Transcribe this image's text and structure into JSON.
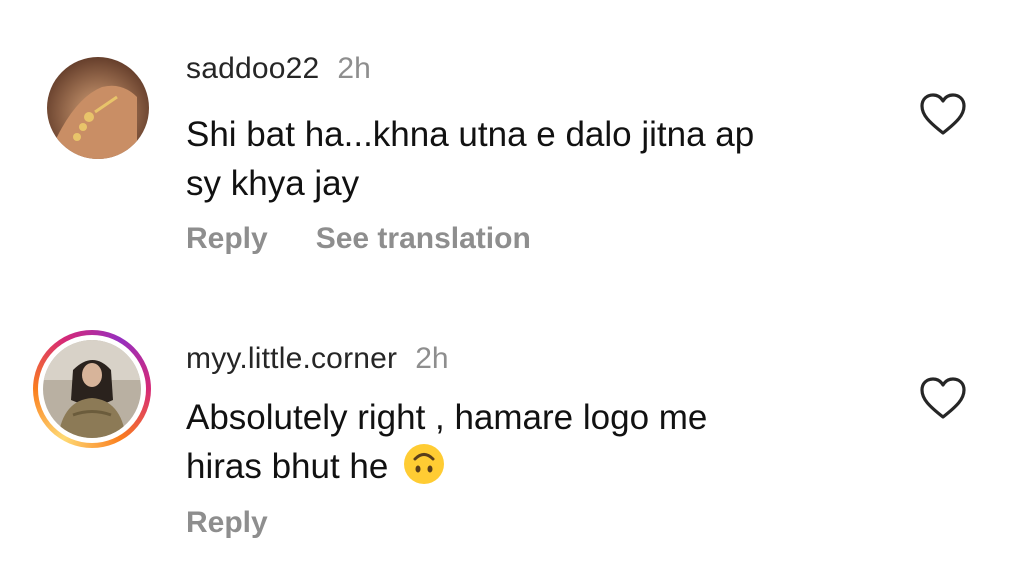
{
  "comments": [
    {
      "username": "saddoo22",
      "time": "2h",
      "text_line1": "Shi bat ha...khna utna e dalo jitna ap",
      "text_line2": "sy khya jay",
      "reply_label": "Reply",
      "translate_label": "See translation",
      "has_story_ring": false
    },
    {
      "username": "myy.little.corner",
      "time": "2h",
      "text_line1": "Absolutely right , hamare logo me",
      "text_line2": "hiras bhut he",
      "emoji": "upside-down-face",
      "reply_label": "Reply",
      "has_story_ring": true
    }
  ],
  "icons": {
    "like": "heart-outline-icon"
  },
  "colors": {
    "muted": "#8e8e8e",
    "text": "#111111"
  }
}
